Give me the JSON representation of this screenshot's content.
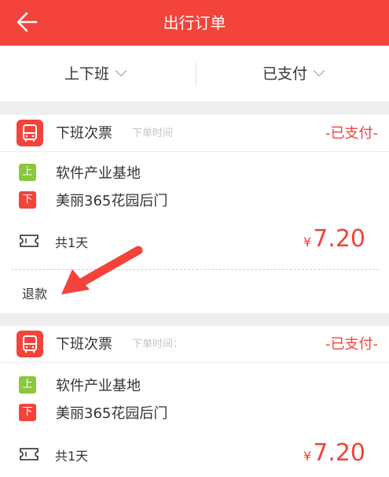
{
  "header": {
    "title": "出行订单",
    "back_icon": "arrow-left-icon"
  },
  "filters": {
    "route_type": "上下班",
    "pay_status": "已支付"
  },
  "orders": [
    {
      "ticket_type": "下班次票",
      "order_time_label": "下单时间",
      "status": "-已支付-",
      "board_badge": "上",
      "board_stop": "软件产业基地",
      "alight_badge": "下",
      "alight_stop": "美丽365花园后门",
      "days": "共1天",
      "currency": "¥",
      "price": "7.20",
      "refund_label": "退款"
    },
    {
      "ticket_type": "下班次票",
      "order_time_label": "下单时间：",
      "status": "-已支付-",
      "board_badge": "上",
      "board_stop": "软件产业基地",
      "alight_badge": "下",
      "alight_stop": "美丽365花园后门",
      "days": "共1天",
      "currency": "¥",
      "price": "7.20"
    }
  ],
  "colors": {
    "accent": "#f3433b",
    "board": "#8cc63f"
  }
}
